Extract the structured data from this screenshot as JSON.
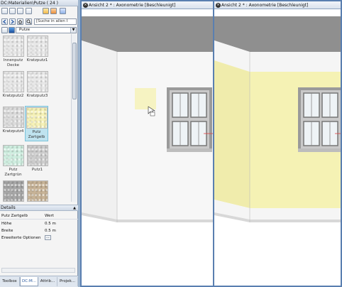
{
  "panel": {
    "title": "DC:Materialien\\Putze ( 24 )",
    "search_placeholder": "[Suche in allen I",
    "folder": "Putze"
  },
  "materials": [
    {
      "label": "Innenputz Decke",
      "color": "#ececec"
    },
    {
      "label": "Kratzputz1",
      "color": "#ebebeb"
    },
    {
      "label": "Kratzputz2",
      "color": "#e9e9e9"
    },
    {
      "label": "Kratzputz3",
      "color": "#e6e6e6"
    },
    {
      "label": "Kratzputz4",
      "color": "#dedede"
    },
    {
      "label": "Putz Zartgelb",
      "color": "#f6f2b8",
      "selected": true
    },
    {
      "label": "Putz Zartgrün",
      "color": "#cfeee0"
    },
    {
      "label": "Putz1",
      "color": "#cfcfcf"
    },
    {
      "label": "",
      "color": "#a9a9a9"
    },
    {
      "label": "",
      "color": "#c9b59a"
    }
  ],
  "details": {
    "header": "Details",
    "col_name": "Putz Zartgelb",
    "col_value": "Wert",
    "rows": [
      {
        "key": "Höhe",
        "value": "0.5 m"
      },
      {
        "key": "Breite",
        "value": "0.5 m"
      },
      {
        "key": "Erweiterte Optionen",
        "value": "..."
      }
    ]
  },
  "tabs": [
    "Toolbox",
    "DC:M...",
    "Attrib...",
    "Projek..."
  ],
  "active_tab": 1,
  "views": [
    {
      "title": "Ansicht 2 * : Axonometrie [Beschleunigt]",
      "wall_color": "#f7f7f7"
    },
    {
      "title": "Ansicht 2 * : Axonometrie [Beschleunigt]",
      "wall_color": "#f5f2b4"
    }
  ],
  "colors": {
    "accent": "#5a7fb0",
    "selection": "#bfe3ef"
  }
}
